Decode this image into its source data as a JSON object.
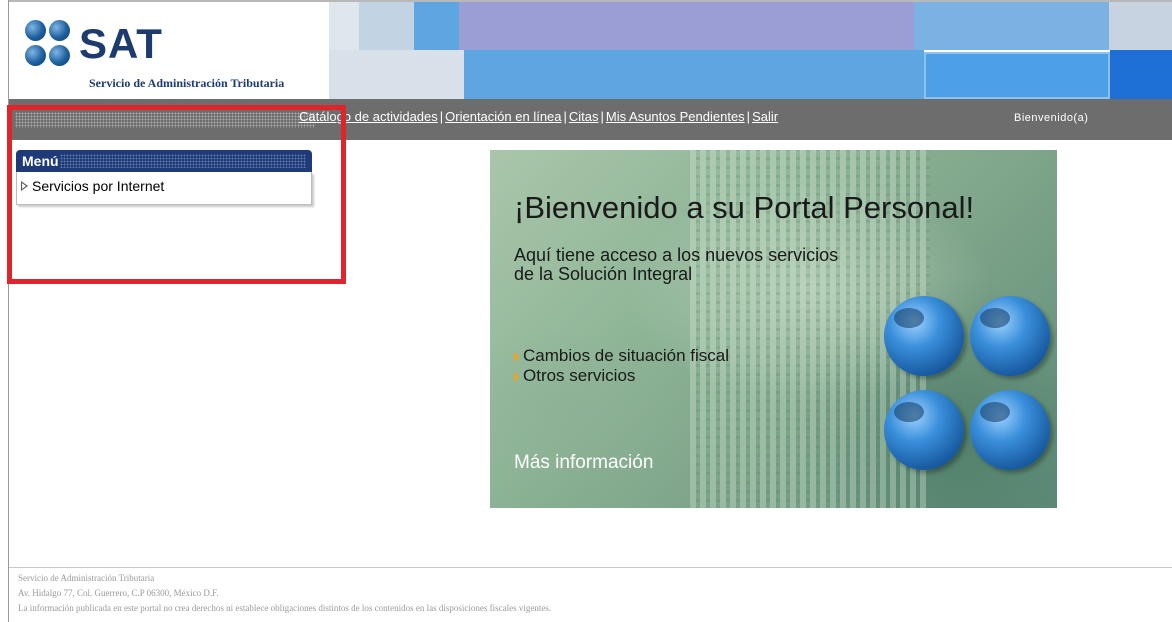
{
  "header": {
    "logo_word": "SAT",
    "logo_subtitle": "Servicio de Administración Tributaria"
  },
  "nav": {
    "links": [
      {
        "label": "Catálogo de actividades"
      },
      {
        "label": "Orientación en línea"
      },
      {
        "label": "Citas"
      },
      {
        "label": "Mis Asuntos Pendientes"
      },
      {
        "label": "Salir"
      }
    ],
    "welcome": "Bienvenido(a)"
  },
  "menu": {
    "title": "Menú",
    "items": [
      {
        "label": "Servicios por Internet"
      }
    ]
  },
  "banner": {
    "title": "¡Bienvenido a su Portal Personal!",
    "subtitle_line1": "Aquí tiene acceso a los nuevos servicios",
    "subtitle_line2": "de la Solución Integral",
    "items": [
      "Cambios de situación fiscal",
      "Otros servicios"
    ],
    "more": "Más información"
  },
  "footer": {
    "line1": "Servicio de Administración Tributaria",
    "line2": "Av. Hidalgo 77, Col. Guerrero, C.P 06300, México D.F.",
    "line3": "La información publicada en este portal no crea derechos ni establece obligaciones distintos de los contenidos en las disposiciones fiscales vigentes."
  },
  "colors": {
    "nav_bar": "#6d6d6d",
    "menu_header": "#1f3a78",
    "highlight_box": "#e0242b",
    "logo_blue": "#1d3b6e"
  }
}
